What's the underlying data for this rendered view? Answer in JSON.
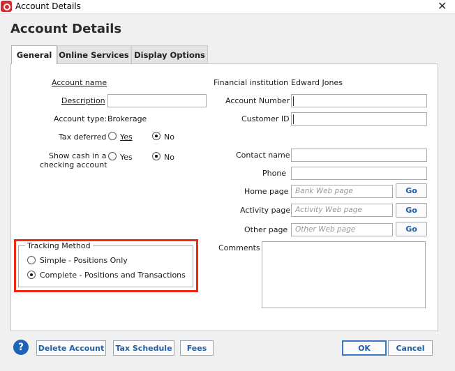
{
  "window": {
    "title": "Account Details",
    "close_glyph": "✕",
    "icon": "quicken-logo-icon"
  },
  "dialog": {
    "heading": "Account Details"
  },
  "tabs": [
    {
      "label": "General",
      "active": true
    },
    {
      "label": "Online Services",
      "active": false
    },
    {
      "label": "Display Options",
      "active": false
    }
  ],
  "left": {
    "account_name_label": "Account name",
    "account_name_value": "",
    "description_label": "Description",
    "description_value": "",
    "account_type_label": "Account type:",
    "account_type_value": "Brokerage",
    "tax_deferred_label": "Tax deferred",
    "tax_deferred_selected": "No",
    "show_cash_label_1": "Show cash in a",
    "show_cash_label_2": "checking account",
    "show_cash_selected": "No",
    "yes_label": "Yes",
    "no_label": "No"
  },
  "right": {
    "financial_institution_label": "Financial institution",
    "financial_institution_value": "Edward Jones",
    "account_number_label": "Account Number",
    "customer_id_label": "Customer ID",
    "contact_name_label": "Contact name",
    "phone_label": "Phone",
    "home_page_label": "Home page",
    "home_page_placeholder": "Bank Web page",
    "activity_page_label": "Activity page",
    "activity_page_placeholder": "Activity Web page",
    "other_page_label": "Other page",
    "other_page_placeholder": "Other Web page",
    "go_label": "Go",
    "comments_label": "Comments"
  },
  "tracking": {
    "title": "Tracking Method",
    "option_simple": "Simple - Positions Only",
    "option_complete": "Complete - Positions and Transactions",
    "selected": "complete",
    "highlight_color": "#f02a12"
  },
  "footer": {
    "help_glyph": "?",
    "delete_label": "Delete Account",
    "tax_schedule_label": "Tax Schedule",
    "fees_label": "Fees",
    "ok_label": "OK",
    "cancel_label": "Cancel"
  },
  "colors": {
    "accent": "#1f5fa8",
    "brand": "#d7282f"
  }
}
